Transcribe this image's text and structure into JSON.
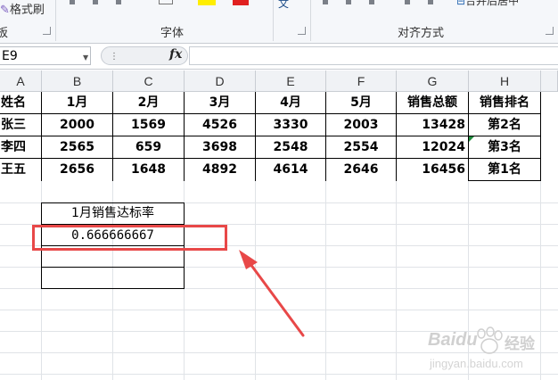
{
  "ribbon": {
    "group_clipboard": "板",
    "format_painter_label": "格式刷",
    "group_font": "字体",
    "group_alignment": "对齐方式",
    "merge_center_partial": "合并后居中",
    "wrap_partial": "文"
  },
  "formula_bar": {
    "name_box": "E9",
    "fx_label": "fx",
    "formula": ""
  },
  "columns": [
    "A",
    "B",
    "C",
    "D",
    "E",
    "F",
    "G",
    "H"
  ],
  "table": {
    "headers": [
      "姓名",
      "1月",
      "2月",
      "3月",
      "4月",
      "5月",
      "销售总额",
      "销售排名"
    ],
    "rows": [
      [
        "张三",
        "2000",
        "1569",
        "4526",
        "3330",
        "2003",
        "13428",
        "第2名"
      ],
      [
        "李四",
        "2565",
        "659",
        "3698",
        "2548",
        "2554",
        "12024",
        "第3名"
      ],
      [
        "王五",
        "2656",
        "1648",
        "4892",
        "4614",
        "2646",
        "16456",
        "第1名"
      ]
    ]
  },
  "sub_table": {
    "header": "1月销售达标率",
    "value": "0.666666667"
  },
  "colors": {
    "highlight": "#e84848",
    "font_color_red": "#e02020",
    "fill_color_yellow": "#ffee00",
    "comment_marker": "#1e8c3c"
  },
  "watermark": {
    "brand": "Baidu",
    "suffix": "经验",
    "domain": "jingyan.baidu.com"
  }
}
